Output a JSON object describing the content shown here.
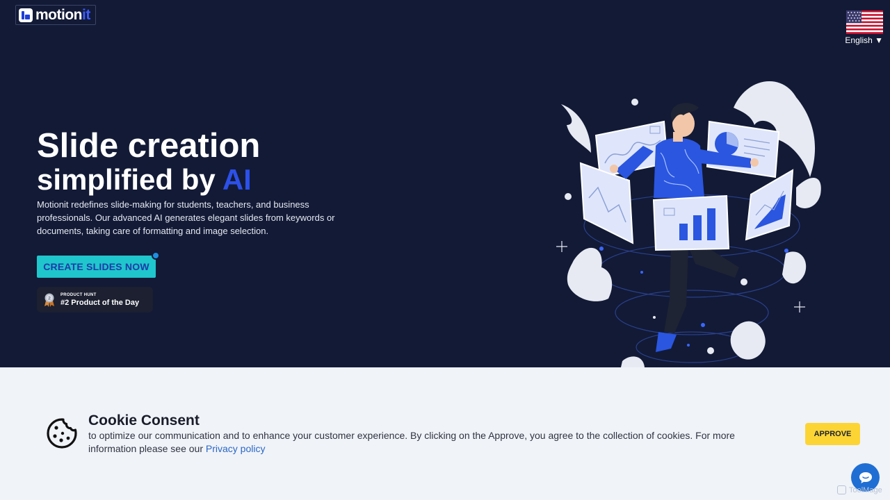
{
  "header": {
    "logo_text_main": "motion",
    "logo_text_accent": "it",
    "language": "English ▼"
  },
  "hero": {
    "headline_line1": "Slide creation",
    "headline_line2_prefix": "simplified by ",
    "headline_line2_accent": "AI",
    "description": "Motionit redefines slide-making for students, teachers, and business professionals. Our advanced AI generates elegant slides from keywords or documents, taking care of formatting and image selection.",
    "cta_label": "CREATE SLIDES NOW",
    "badge_small": "PRODUCT HUNT",
    "badge_big": "#2 Product of the Day"
  },
  "cookie": {
    "title": "Cookie Consent",
    "text": "to optimize our communication and to enhance your customer experience. By clicking on the Approve, you agree to the collection of cookies. For more information please see our ",
    "link": "Privacy policy",
    "approve_label": "APPROVE"
  },
  "watermark": "ToolMage",
  "colors": {
    "hero_bg": "#121a36",
    "accent_blue": "#2c50e8",
    "cta_bg": "#1fc6cc",
    "approve_bg": "#fcd535",
    "cookie_bg": "#f0f3f8"
  },
  "icons": {
    "flag": "us-flag-icon",
    "medal": "medal-icon",
    "cookie": "cookie-icon",
    "chat": "chat-bubble-icon"
  }
}
